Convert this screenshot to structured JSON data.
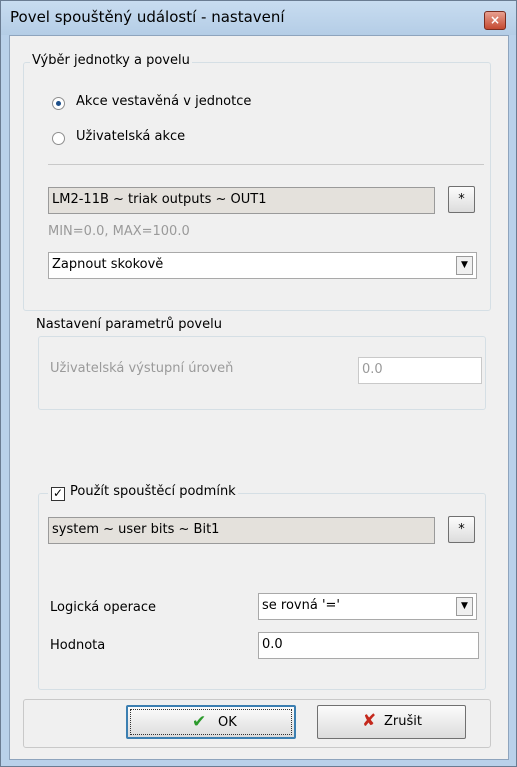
{
  "window": {
    "title": "Povel spouštěný událostí - nastavení",
    "close": "×"
  },
  "group1": {
    "legend": "Výběr jednotky a povelu",
    "radio1": "Akce vestavěná v jednotce",
    "radio2": "Uživatelská akce",
    "selected_radio": "radio1",
    "unit_path": "LM2-11B ~ triak outputs ~ OUT1",
    "browse": "*",
    "range": "MIN=0.0, MAX=100.0",
    "command": "Zapnout skokově"
  },
  "group2": {
    "legend": "Nastavení parametrů povelu",
    "level_label": "Uživatelská výstupní úroveň",
    "level_value": "0.0"
  },
  "group3": {
    "legend": "Použít spouštěcí podmínk",
    "checked": true,
    "path": "system ~ user bits ~ Bit1",
    "browse": "*",
    "op_label": "Logická operace",
    "op_value": "se rovná '='",
    "value_label": "Hodnota",
    "value": "0.0"
  },
  "buttons": {
    "ok": "OK",
    "cancel": "Zrušit"
  },
  "colors": {
    "titlebar": "#b9d1ea",
    "accent": "#1d4f8a",
    "ok_check": "#2c9a2c",
    "cancel_x": "#c4281c"
  }
}
